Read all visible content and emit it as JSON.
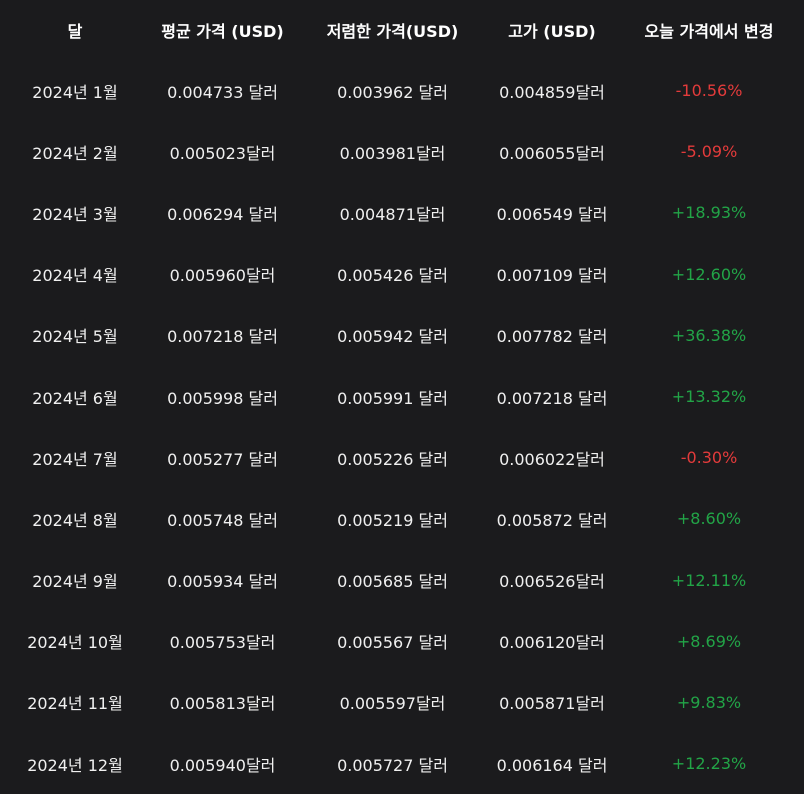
{
  "colors": {
    "background": "#1b1b1d",
    "text": "#f0f0f0",
    "negative": "#e33b3b",
    "positive": "#22a447"
  },
  "table": {
    "headers": [
      "달",
      "평균 가격 (USD)",
      "저렴한 가격(USD)",
      "고가 (USD)",
      "오늘 가격에서 변경"
    ],
    "rows": [
      {
        "month": "2024년 1월",
        "avg": "0.004733 달러",
        "low": "0.003962 달러",
        "high": "0.004859달러",
        "change": "-10.56%",
        "trend": "neg"
      },
      {
        "month": "2024년 2월",
        "avg": "0.005023달러",
        "low": "0.003981달러",
        "high": "0.006055달러",
        "change": "-5.09%",
        "trend": "neg"
      },
      {
        "month": "2024년 3월",
        "avg": "0.006294 달러",
        "low": "0.004871달러",
        "high": "0.006549 달러",
        "change": "+18.93%",
        "trend": "pos"
      },
      {
        "month": "2024년 4월",
        "avg": "0.005960달러",
        "low": "0.005426 달러",
        "high": "0.007109 달러",
        "change": "+12.60%",
        "trend": "pos"
      },
      {
        "month": "2024년 5월",
        "avg": "0.007218 달러",
        "low": "0.005942 달러",
        "high": "0.007782 달러",
        "change": "+36.38%",
        "trend": "pos"
      },
      {
        "month": "2024년 6월",
        "avg": "0.005998 달러",
        "low": "0.005991 달러",
        "high": "0.007218 달러",
        "change": "+13.32%",
        "trend": "pos"
      },
      {
        "month": "2024년 7월",
        "avg": "0.005277 달러",
        "low": "0.005226 달러",
        "high": "0.006022달러",
        "change": "-0.30%",
        "trend": "neg"
      },
      {
        "month": "2024년 8월",
        "avg": "0.005748 달러",
        "low": "0.005219 달러",
        "high": "0.005872 달러",
        "change": "+8.60%",
        "trend": "pos"
      },
      {
        "month": "2024년 9월",
        "avg": "0.005934 달러",
        "low": "0.005685 달러",
        "high": "0.006526달러",
        "change": "+12.11%",
        "trend": "pos"
      },
      {
        "month": "2024년 10월",
        "avg": "0.005753달러",
        "low": "0.005567 달러",
        "high": "0.006120달러",
        "change": "+8.69%",
        "trend": "pos"
      },
      {
        "month": "2024년 11월",
        "avg": "0.005813달러",
        "low": "0.005597달러",
        "high": "0.005871달러",
        "change": "+9.83%",
        "trend": "pos"
      },
      {
        "month": "2024년 12월",
        "avg": "0.005940달러",
        "low": "0.005727 달러",
        "high": "0.006164 달러",
        "change": "+12.23%",
        "trend": "pos"
      }
    ]
  }
}
